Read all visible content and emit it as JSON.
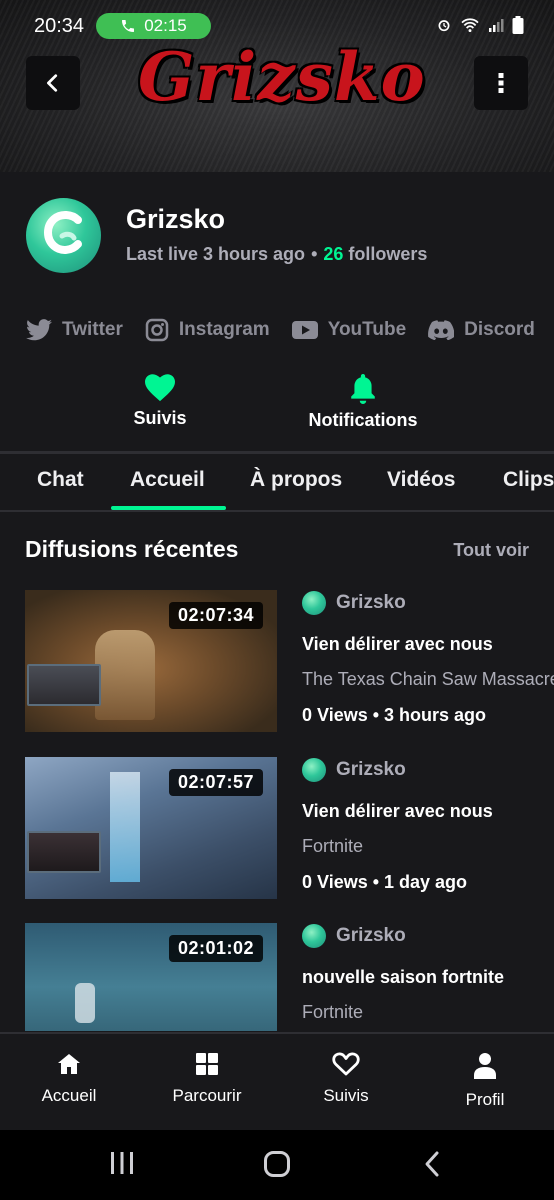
{
  "status_bar": {
    "time": "20:34",
    "call_timer": "02:15"
  },
  "banner": {
    "logo_text": "Grizsko"
  },
  "channel": {
    "name": "Grizsko",
    "last_live": "Last live 3 hours ago",
    "separator": "•",
    "followers_count": "26",
    "followers_label": "followers"
  },
  "socials": [
    {
      "label": "Twitter",
      "icon": "twitter-icon"
    },
    {
      "label": "Instagram",
      "icon": "instagram-icon"
    },
    {
      "label": "YouTube",
      "icon": "youtube-icon"
    },
    {
      "label": "Discord",
      "icon": "discord-icon"
    }
  ],
  "actions": {
    "follow_label": "Suivis",
    "notifications_label": "Notifications"
  },
  "tabs": [
    "Chat",
    "Accueil",
    "À propos",
    "Vidéos",
    "Clips"
  ],
  "active_tab": "Accueil",
  "section": {
    "title": "Diffusions récentes",
    "see_all": "Tout voir"
  },
  "videos": [
    {
      "duration": "02:07:34",
      "author": "Grizsko",
      "title": "Vien délirer avec nous",
      "game": "The Texas Chain Saw Massacre",
      "stats": "0 Views • 3 hours ago"
    },
    {
      "duration": "02:07:57",
      "author": "Grizsko",
      "title": "Vien délirer avec nous",
      "game": "Fortnite",
      "stats": "0 Views • 1 day ago"
    },
    {
      "duration": "02:01:02",
      "author": "Grizsko",
      "title": "nouvelle saison fortnite",
      "game": "Fortnite",
      "stats": ""
    }
  ],
  "bottom_nav": [
    {
      "label": "Accueil",
      "icon": "home-icon"
    },
    {
      "label": "Parcourir",
      "icon": "browse-icon"
    },
    {
      "label": "Suivis",
      "icon": "heart-icon"
    },
    {
      "label": "Profil",
      "icon": "profile-icon"
    }
  ],
  "colors": {
    "accent": "#00f593",
    "background": "#18181b",
    "call_pill": "#3fbf54",
    "banner_logo": "#c8141c"
  }
}
